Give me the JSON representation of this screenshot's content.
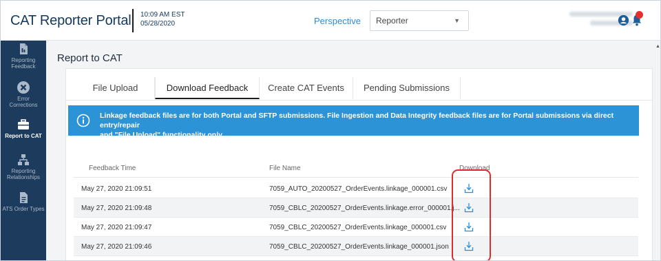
{
  "header": {
    "app_title": "CAT Reporter Portal",
    "time": "10:09 AM EST",
    "date": "05/28/2020",
    "perspective_label": "Perspective",
    "perspective_value": "Reporter"
  },
  "sidebar": {
    "items": [
      {
        "label_line1": "Reporting",
        "label_line2": "Feedback",
        "icon": "file-icon",
        "active": false
      },
      {
        "label_line1": "Error",
        "label_line2": "Corrections",
        "icon": "x-circle-icon",
        "active": false
      },
      {
        "label_line1": "Report to CAT",
        "label_line2": "",
        "icon": "briefcase-icon",
        "active": true
      },
      {
        "label_line1": "Reporting",
        "label_line2": "Relationships",
        "icon": "hierarchy-icon",
        "active": false
      },
      {
        "label_line1": "ATS Order Types",
        "label_line2": "",
        "icon": "document-icon",
        "active": false
      }
    ]
  },
  "page": {
    "title": "Report to CAT",
    "tabs": [
      {
        "label": "File Upload",
        "active": false
      },
      {
        "label": "Download Feedback",
        "active": true
      },
      {
        "label": "Create CAT Events",
        "active": false
      },
      {
        "label": "Pending Submissions",
        "active": false
      }
    ],
    "banner_line1": "Linkage feedback files are for both Portal and SFTP submissions. File Ingestion and Data Integrity feedback files are for Portal submissions via direct entry/repair",
    "banner_line2": "and \"File Upload\" functionality only."
  },
  "table": {
    "columns": [
      "Feedback Time",
      "File Name",
      "Download"
    ],
    "rows": [
      {
        "time": "May 27, 2020 21:09:51",
        "file": "7059_AUTO_20200527_OrderEvents.linkage_000001.csv"
      },
      {
        "time": "May 27, 2020 21:09:48",
        "file": "7059_CBLC_20200527_OrderEvents.linkage.error_000001.j..."
      },
      {
        "time": "May 27, 2020 21:09:47",
        "file": "7059_CBLC_20200527_OrderEvents.linkage_000001.csv"
      },
      {
        "time": "May 27, 2020 21:09:46",
        "file": "7059_CBLC_20200527_OrderEvents.linkage_000001.json"
      }
    ]
  },
  "colors": {
    "sidebar": "#1d3b5c",
    "banner": "#2b93d6",
    "highlight": "#e02b2b",
    "accent": "#2a8ed3"
  }
}
